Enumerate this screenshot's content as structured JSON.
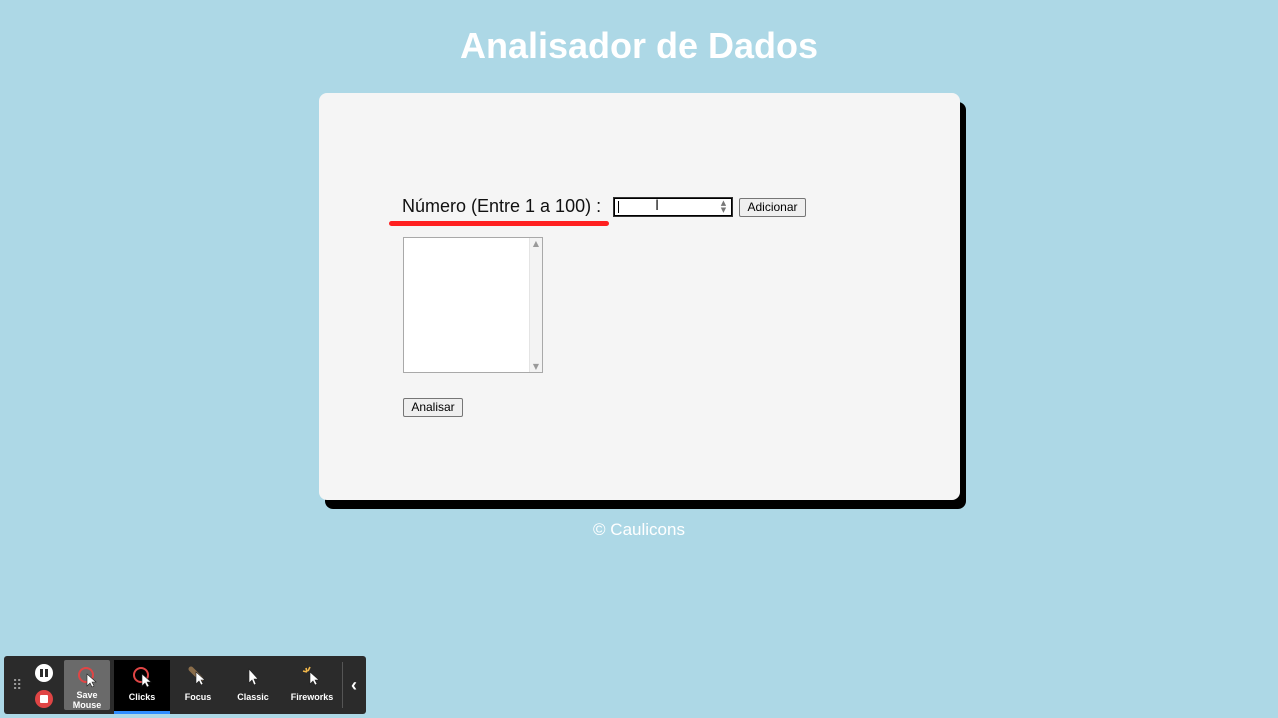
{
  "page": {
    "title": "Analisador de Dados",
    "footer": "© Caulicons"
  },
  "form": {
    "number_label": "Número (Entre 1 a 100) :",
    "number_value": "",
    "add_button": "Adicionar",
    "analyze_button": "Analisar"
  },
  "colors": {
    "background": "#add8e6",
    "card": "#f5f5f5",
    "underline": "#ff2020",
    "recorder_accent": "#2f8dff"
  },
  "recorder": {
    "tools": [
      {
        "label": "Save Mouse",
        "icon": "cursor-ring-icon"
      },
      {
        "label": "Clicks",
        "icon": "click-ring-icon",
        "active": true
      },
      {
        "label": "Focus",
        "icon": "spotlight-cursor-icon"
      },
      {
        "label": "Classic",
        "icon": "arrow-cursor-icon"
      },
      {
        "label": "Fireworks",
        "icon": "sparkle-cursor-icon"
      }
    ]
  }
}
